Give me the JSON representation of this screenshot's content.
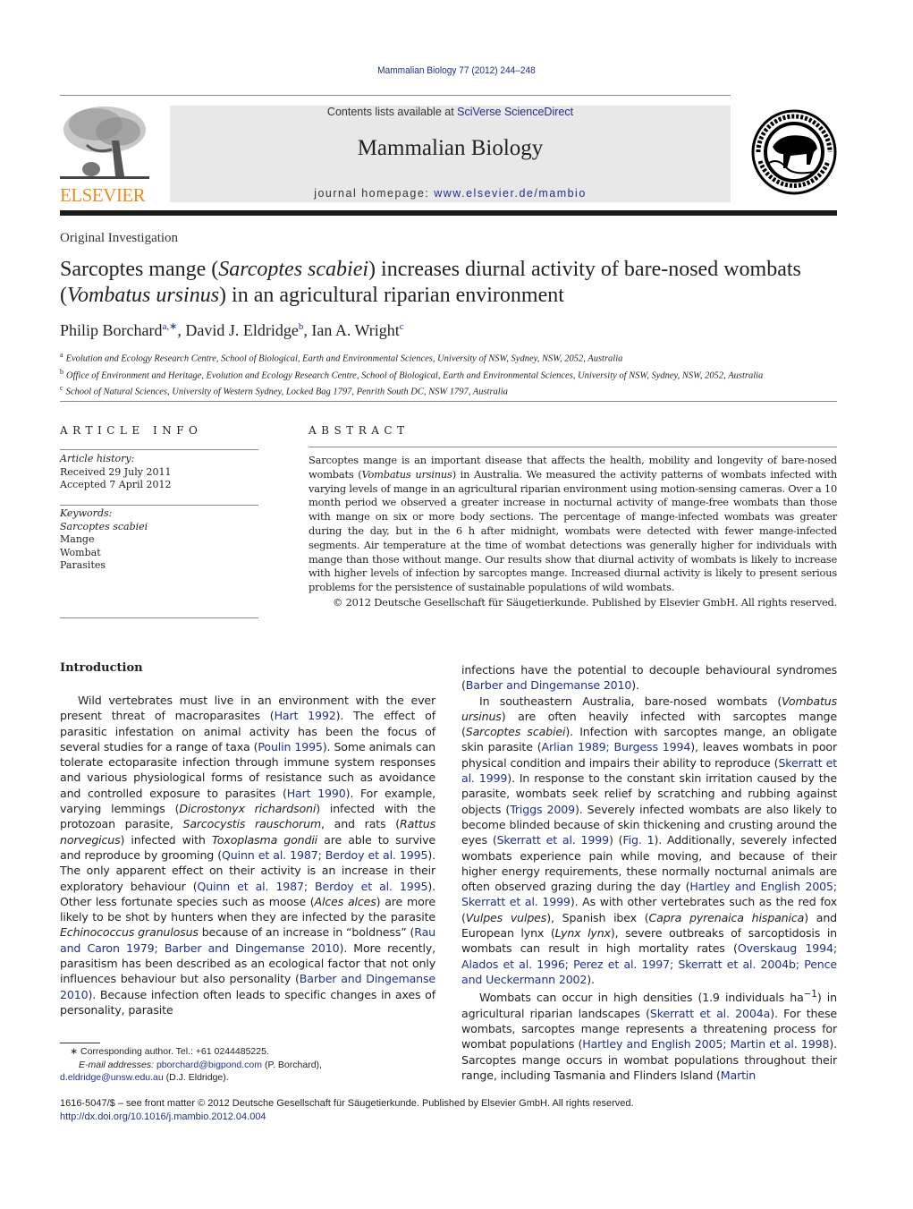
{
  "header": {
    "journal_reference": "Mammalian Biology 77 (2012) 244–248",
    "contents_prefix": "Contents lists available at ",
    "contents_link": "SciVerse ScienceDirect",
    "journal_name": "Mammalian Biology",
    "homepage_prefix": "journal homepage: ",
    "homepage_link": "www.elsevier.de/mambio",
    "publisher_logo_text": "ELSEVIER",
    "publisher_logo_color": "#f08a1c",
    "society_logo_text": "DEUTSCHE GESELLSCHAFT FÜR SÄUGETIERKUNDE E.V. BERLIN",
    "link_color": "#1f2f8c"
  },
  "article": {
    "section_type": "Original Investigation",
    "title_parts": [
      "Sarcoptes mange (",
      "Sarcoptes scabiei",
      ") increases diurnal activity of bare-nosed wombats (",
      "Vombatus ursinus",
      ") in an agricultural riparian environment"
    ],
    "authors": [
      {
        "name": "Philip Borchard",
        "affil": "a,∗"
      },
      {
        "name": "David J. Eldridge",
        "affil": "b"
      },
      {
        "name": "Ian A. Wright",
        "affil": "c"
      }
    ],
    "affiliations": [
      {
        "mark": "a",
        "text": "Evolution and Ecology Research Centre, School of Biological, Earth and Environmental Sciences, University of NSW, Sydney, NSW, 2052, Australia"
      },
      {
        "mark": "b",
        "text": "Office of Environment and Heritage, Evolution and Ecology Research Centre, School of Biological, Earth and Environmental Sciences, University of NSW, Sydney, NSW, 2052, Australia"
      },
      {
        "mark": "c",
        "text": "School of Natural Sciences, University of Western Sydney, Locked Bag 1797, Penrith South DC, NSW 1797, Australia"
      }
    ]
  },
  "article_info": {
    "heading": "ARTICLE INFO",
    "history_label": "Article history:",
    "received": "Received 29 July 2011",
    "accepted": "Accepted 7 April 2012",
    "keywords_label": "Keywords:",
    "keywords": [
      "Sarcoptes scabiei",
      "Mange",
      "Wombat",
      "Parasites"
    ]
  },
  "abstract": {
    "heading": "ABSTRACT",
    "parts": [
      "Sarcoptes mange is an important disease that affects the health, mobility and longevity of bare-nosed wombats (",
      "Vombatus ursinus",
      ") in Australia. We measured the activity patterns of wombats infected with varying levels of mange in an agricultural riparian environment using motion-sensing cameras. Over a 10 month period we observed a greater increase in nocturnal activity of mange-free wombats than those with mange on six or more body sections. The percentage of mange-infected wombats was greater during the day, but in the 6 h after midnight, wombats were detected with fewer mange-infected segments. Air temperature at the time of wombat detections was generally higher for individuals with mange than those without mange. Our results show that diurnal activity of wombats is likely to increase with higher levels of infection by sarcoptes mange. Increased diurnal activity is likely to present serious problems for the persistence of sustainable populations of wild wombats."
    ],
    "copyright": "© 2012  Deutsche Gesellschaft für Säugetierkunde. Published by Elsevier GmbH. All rights reserved."
  },
  "introduction": {
    "heading": "Introduction",
    "left_paragraph": [
      {
        "t": "Wild vertebrates must live in an environment with the ever present threat of macroparasites ("
      },
      {
        "l": "Hart 1992"
      },
      {
        "t": "). The effect of parasitic infestation on animal activity has been the focus of several studies for a range of taxa ("
      },
      {
        "l": "Poulin 1995"
      },
      {
        "t": "). Some animals can tolerate ectoparasite infection through immune system responses and various physiological forms of resistance such as avoidance and controlled exposure to parasites ("
      },
      {
        "l": "Hart 1990"
      },
      {
        "t": "). For example, varying lemmings ("
      },
      {
        "i": "Dicrostonyx richardsoni"
      },
      {
        "t": ") infected with the protozoan parasite, "
      },
      {
        "i": "Sarcocystis rauschorum"
      },
      {
        "t": ", and rats ("
      },
      {
        "i": "Rattus norvegicus"
      },
      {
        "t": ") infected with "
      },
      {
        "i": "Toxoplasma gondii"
      },
      {
        "t": " are able to survive and reproduce by grooming ("
      },
      {
        "l": "Quinn et al. 1987; Berdoy et al. 1995"
      },
      {
        "t": "). The only apparent effect on their activity is an increase in their exploratory behaviour ("
      },
      {
        "l": "Quinn et al. 1987; Berdoy et al. 1995"
      },
      {
        "t": "). Other less fortunate species such as moose ("
      },
      {
        "i": "Alces alces"
      },
      {
        "t": ") are more likely to be shot by hunters when they are infected by the parasite "
      },
      {
        "i": "Echinococcus granulosus"
      },
      {
        "t": " because of an increase in “boldness” ("
      },
      {
        "l": "Rau and Caron 1979; Barber and Dingemanse 2010"
      },
      {
        "t": "). More recently, parasitism has been described as an ecological factor that not only influences behaviour but also personality ("
      },
      {
        "l": "Barber and Dingemanse 2010"
      },
      {
        "t": "). Because infection often leads to specific changes in axes of personality, parasite"
      }
    ],
    "right_continuation": [
      {
        "t": "infections have the potential to decouple behavioural syndromes ("
      },
      {
        "l": "Barber and Dingemanse 2010"
      },
      {
        "t": ")."
      }
    ],
    "right_paragraph_2": [
      {
        "t": "In southeastern Australia, bare-nosed wombats ("
      },
      {
        "i": "Vombatus ursinus"
      },
      {
        "t": ") are often heavily infected with sarcoptes mange ("
      },
      {
        "i": "Sarcoptes scabiei"
      },
      {
        "t": "). Infection with sarcoptes mange, an obligate skin parasite ("
      },
      {
        "l": "Arlian 1989; Burgess 1994"
      },
      {
        "t": "), leaves wombats in poor physical condition and impairs their ability to reproduce ("
      },
      {
        "l": "Skerratt et al. 1999"
      },
      {
        "t": "). In response to the constant skin irritation caused by the parasite, wombats seek relief by scratching and rubbing against objects ("
      },
      {
        "l": "Triggs 2009"
      },
      {
        "t": "). Severely infected wombats are also likely to become blinded because of skin thickening and crusting around the eyes ("
      },
      {
        "l": "Skerratt et al. 1999"
      },
      {
        "t": ") ("
      },
      {
        "l": "Fig. 1"
      },
      {
        "t": "). Additionally, severely infected wombats experience pain while moving, and because of their higher energy requirements, these normally nocturnal animals are often observed grazing during the day ("
      },
      {
        "l": "Hartley and English 2005; Skerratt et al. 1999"
      },
      {
        "t": "). As with other vertebrates such as the red fox ("
      },
      {
        "i": "Vulpes vulpes"
      },
      {
        "t": "), Spanish ibex ("
      },
      {
        "i": "Capra pyrenaica hispanica"
      },
      {
        "t": ") and European lynx ("
      },
      {
        "i": "Lynx lynx"
      },
      {
        "t": "), severe outbreaks of sarcoptidosis in wombats can result in high mortality rates ("
      },
      {
        "l": "Overskaug 1994; Alados et al. 1996; Perez et al. 1997; Skerratt et al. 2004b; Pence and Ueckermann 2002"
      },
      {
        "t": ")."
      }
    ],
    "right_paragraph_3": [
      {
        "t": "Wombats can occur in high densities (1.9 individuals ha"
      },
      {
        "s": "−1"
      },
      {
        "t": ") in agricultural riparian landscapes ("
      },
      {
        "l": "Skerratt et al. 2004a"
      },
      {
        "t": "). For these wombats, sarcoptes mange represents a threatening process for wombat populations ("
      },
      {
        "l": "Hartley and English 2005; Martin et al. 1998"
      },
      {
        "t": "). Sarcoptes mange occurs in wombat populations throughout their range, including Tasmania and Flinders Island ("
      },
      {
        "l": "Martin"
      }
    ]
  },
  "footnote": {
    "star": "∗",
    "corresponding": "Corresponding author. Tel.: +61 0244485225.",
    "email_label": "E-mail addresses:",
    "email_1": "pborchard@bigpond.com",
    "email_1_owner": " (P. Borchard),",
    "email_2": "d.eldridge@unsw.edu.au",
    "email_2_owner": " (D.J. Eldridge)."
  },
  "bottom": {
    "issn_line": "1616-5047/$ – see front matter © 2012  Deutsche Gesellschaft für Säugetierkunde. Published by Elsevier GmbH. All rights reserved.",
    "doi": "http://dx.doi.org/10.1016/j.mambio.2012.04.004"
  }
}
